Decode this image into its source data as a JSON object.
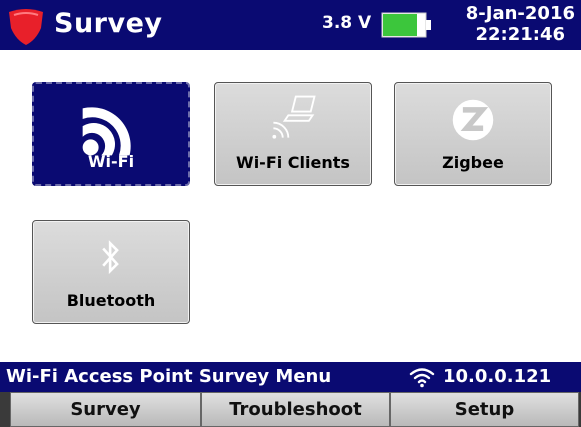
{
  "header": {
    "title": "Survey",
    "voltage": "3.8 V",
    "battery_level": 0.8,
    "date": "8-Jan-2016",
    "time": "22:21:46",
    "brand_color": "#e8202a",
    "bar_color": "#0a0a72"
  },
  "tiles": [
    {
      "label": "Wi-Fi",
      "icon": "wifi-icon",
      "selected": true
    },
    {
      "label": "Wi-Fi Clients",
      "icon": "laptop-wifi-icon",
      "selected": false
    },
    {
      "label": "Zigbee",
      "icon": "zigbee-icon",
      "selected": false
    },
    {
      "label": "Bluetooth",
      "icon": "bluetooth-icon",
      "selected": false
    }
  ],
  "status": {
    "text": "Wi-Fi Access Point Survey Menu",
    "ip": "10.0.0.121",
    "icon": "wifi-signal-icon"
  },
  "tabs": [
    {
      "label": "Survey"
    },
    {
      "label": "Troubleshoot"
    },
    {
      "label": "Setup"
    }
  ]
}
